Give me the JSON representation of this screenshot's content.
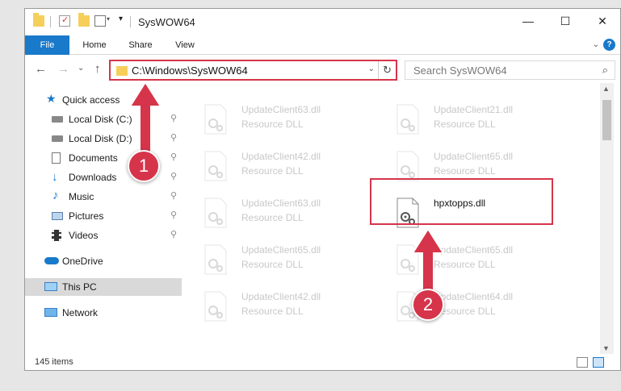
{
  "window": {
    "title": "SysWOW64",
    "minimize_label": "—",
    "maximize_label": "☐",
    "close_label": "✕"
  },
  "ribbon": {
    "tabs": [
      "File",
      "Home",
      "Share",
      "View"
    ],
    "expand_label": "⌄",
    "help_label": "?"
  },
  "navbar": {
    "back_label": "←",
    "forward_label": "→",
    "recent_label": "⌄",
    "up_label": "↑",
    "address": "C:\\Windows\\SysWOW64",
    "address_dropdown": "⌄",
    "refresh_label": "↻",
    "search_placeholder": "Search SysWOW64",
    "search_icon": "⌕"
  },
  "nav_pane": {
    "pin_label": "📌",
    "items": [
      {
        "label": "Quick access",
        "icon": "star-icon"
      },
      {
        "label": "Local Disk (C:)",
        "icon": "drive-icon",
        "pinned": true
      },
      {
        "label": "Local Disk (D:)",
        "icon": "drive-icon",
        "pinned": true
      },
      {
        "label": "Documents",
        "icon": "documents-icon",
        "pinned": true
      },
      {
        "label": "Downloads",
        "icon": "download-icon",
        "pinned": true
      },
      {
        "label": "Music",
        "icon": "music-icon",
        "pinned": true
      },
      {
        "label": "Pictures",
        "icon": "pictures-icon",
        "pinned": true
      },
      {
        "label": "Videos",
        "icon": "videos-icon",
        "pinned": true
      },
      {
        "label": "OneDrive",
        "icon": "cloud-icon"
      },
      {
        "label": "This PC",
        "icon": "computer-icon",
        "selected": true
      },
      {
        "label": "Network",
        "icon": "network-icon"
      }
    ]
  },
  "files": [
    {
      "name": "UpdateClient63.dll",
      "type": "Resource DLL"
    },
    {
      "name": "UpdateClient21.dll",
      "type": "Resource DLL"
    },
    {
      "name": "UpdateClient42.dll",
      "type": "Resource DLL"
    },
    {
      "name": "UpdateClient65.dll",
      "type": "Resource DLL"
    },
    {
      "name": "UpdateClient63.dll",
      "type": "Resource DLL"
    },
    {
      "name": "hpxtopps.dll",
      "type": ""
    },
    {
      "name": "UpdateClient65.dll",
      "type": "Resource DLL"
    },
    {
      "name": "UpdateClient65.dll",
      "type": "Resource DLL"
    },
    {
      "name": "UpdateClient42.dll",
      "type": "Resource DLL"
    },
    {
      "name": "UpdateClient64.dll",
      "type": "Resource DLL"
    }
  ],
  "scrollbar": {
    "up_label": "▲",
    "down_label": "▼"
  },
  "status": {
    "item_count": "145 items"
  },
  "markers": {
    "one": "1",
    "two": "2"
  },
  "colors": {
    "accent": "#1979ca",
    "highlight": "#d6344a"
  }
}
